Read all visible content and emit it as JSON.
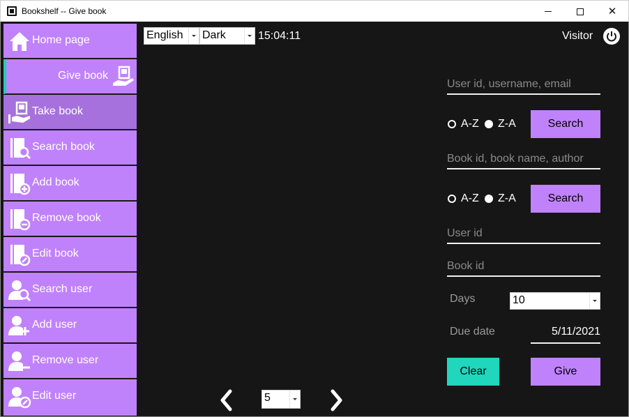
{
  "window": {
    "title": "Bookshelf -- Give book"
  },
  "sidebar": {
    "items": [
      {
        "label": "Home page",
        "icon": "home-icon"
      },
      {
        "label": "Give book",
        "icon": "give-book-icon"
      },
      {
        "label": "Take book",
        "icon": "take-book-icon"
      },
      {
        "label": "Search book",
        "icon": "search-book-icon"
      },
      {
        "label": "Add book",
        "icon": "add-book-icon"
      },
      {
        "label": "Remove book",
        "icon": "remove-book-icon"
      },
      {
        "label": "Edit book",
        "icon": "edit-book-icon"
      },
      {
        "label": "Search user",
        "icon": "search-user-icon"
      },
      {
        "label": "Add user",
        "icon": "add-user-icon"
      },
      {
        "label": "Remove user",
        "icon": "remove-user-icon"
      },
      {
        "label": "Edit user",
        "icon": "edit-user-icon"
      }
    ]
  },
  "header": {
    "language": "English",
    "theme": "Dark",
    "time": "15:04:11",
    "user": "Visitor"
  },
  "form": {
    "user_search_placeholder": "User id, username, email",
    "sort_az": "A-Z",
    "sort_za": "Z-A",
    "search_label": "Search",
    "book_search_placeholder": "Book id, book name, author",
    "user_id_placeholder": "User id",
    "book_id_placeholder": "Book id",
    "days_label": "Days",
    "days_value": "10",
    "due_date_label": "Due date",
    "due_date_value": "5/11/2021",
    "clear_label": "Clear",
    "give_label": "Give"
  },
  "pagination": {
    "page_size": "5"
  },
  "colors": {
    "accent": "#c082fb",
    "accent_active": "#a671dc",
    "teal": "#20d6bd",
    "background": "#161616"
  }
}
